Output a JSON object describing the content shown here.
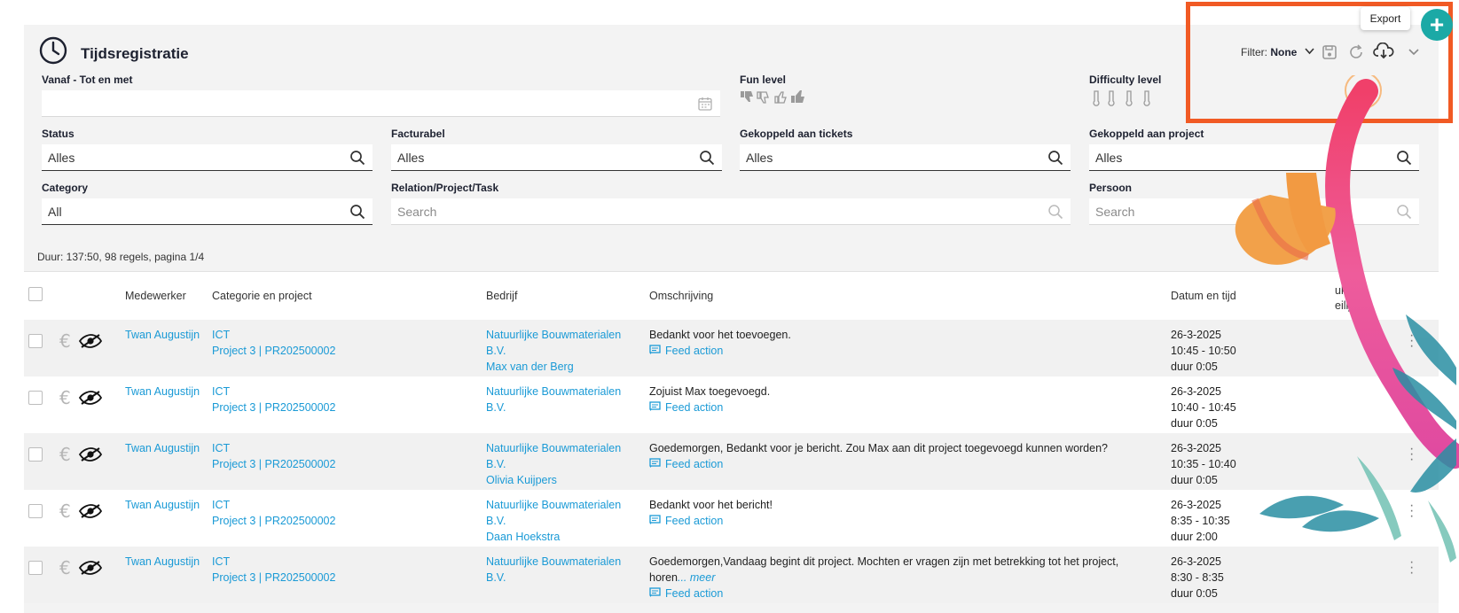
{
  "page": {
    "title": "Tijdsregistratie"
  },
  "toolbar": {
    "filter_label": "Filter:",
    "filter_value": "None",
    "export_tooltip": "Export"
  },
  "filters": {
    "date_range": {
      "label": "Vanaf - Tot en met",
      "value": ""
    },
    "fun_level": {
      "label": "Fun level"
    },
    "difficulty_level": {
      "label": "Difficulty level"
    },
    "status": {
      "label": "Status",
      "value": "Alles"
    },
    "facturabel": {
      "label": "Facturabel",
      "value": "Alles"
    },
    "gekoppeld_tickets": {
      "label": "Gekoppeld aan tickets",
      "value": "Alles"
    },
    "gekoppeld_project": {
      "label": "Gekoppeld aan project",
      "value": "Alles"
    },
    "category": {
      "label": "Category",
      "value": "All"
    },
    "relation": {
      "label": "Relation/Project/Task",
      "placeholder": "Search"
    },
    "persoon": {
      "label": "Persoon",
      "placeholder": "Search"
    }
  },
  "summary": "Duur: 137:50, 98 regels, pagina 1/4",
  "table": {
    "headers": {
      "medewerker": "Medewerker",
      "categorie": "Categorie en project",
      "bedrijf": "Bedrijf",
      "omschrijving": "Omschrijving",
      "datum": "Datum en tijd",
      "extra_1": "uk en",
      "extra_2": "eilijk"
    },
    "rows": [
      {
        "medewerker": "Twan Augustijn",
        "categorie": "ICT",
        "project": "Project 3 | PR202500002",
        "bedrijf_1": "Natuurlijke Bouwmaterialen",
        "bedrijf_2": "B.V.",
        "contact": "Max van der Berg",
        "omschrijving": "Bedankt voor het toevoegen.",
        "more": "",
        "feed": "Feed action",
        "datum": "26-3-2025",
        "tijd": "10:45 - 10:50",
        "duur": "duur 0:05"
      },
      {
        "medewerker": "Twan Augustijn",
        "categorie": "ICT",
        "project": "Project 3 | PR202500002",
        "bedrijf_1": "Natuurlijke Bouwmaterialen",
        "bedrijf_2": "B.V.",
        "contact": "",
        "omschrijving": "Zojuist Max toegevoegd.",
        "more": "",
        "feed": "Feed action",
        "datum": "26-3-2025",
        "tijd": "10:40 - 10:45",
        "duur": "duur 0:05"
      },
      {
        "medewerker": "Twan Augustijn",
        "categorie": "ICT",
        "project": "Project 3 | PR202500002",
        "bedrijf_1": "Natuurlijke Bouwmaterialen",
        "bedrijf_2": "B.V.",
        "contact": "Olivia Kuijpers",
        "omschrijving": "Goedemorgen, Bedankt voor je bericht. Zou Max aan dit project toegevoegd kunnen worden?",
        "more": "",
        "feed": "Feed action",
        "datum": "26-3-2025",
        "tijd": "10:35 - 10:40",
        "duur": "duur 0:05"
      },
      {
        "medewerker": "Twan Augustijn",
        "categorie": "ICT",
        "project": "Project 3 | PR202500002",
        "bedrijf_1": "Natuurlijke Bouwmaterialen",
        "bedrijf_2": "B.V.",
        "contact": "Daan Hoekstra",
        "omschrijving": "Bedankt voor het bericht!",
        "more": "",
        "feed": "Feed action",
        "datum": "26-3-2025",
        "tijd": "8:35 - 10:35",
        "duur": "duur 2:00"
      },
      {
        "medewerker": "Twan Augustijn",
        "categorie": "ICT",
        "project": "Project 3 | PR202500002",
        "bedrijf_1": "Natuurlijke Bouwmaterialen",
        "bedrijf_2": "B.V.",
        "contact": "",
        "omschrijving": "Goedemorgen,Vandaag begint dit project. Mochten er vragen zijn met betrekking tot het project,",
        "omschrijving_2": "horen",
        "more": "... meer",
        "feed": "Feed action",
        "datum": "26-3-2025",
        "tijd": "8:30 - 8:35",
        "duur": "duur 0:05"
      }
    ]
  },
  "colors": {
    "accent_link": "#1a9ad6",
    "highlight": "#f15a24",
    "fab": "#1ba9a6",
    "panel_bg": "#f3f3f3",
    "row_shade": "#f1f1f1"
  },
  "icons": {
    "header": "clock-icon",
    "save": "save-icon",
    "refresh": "refresh-icon",
    "export": "cloud-download-icon",
    "expand": "chevron-down-icon",
    "search": "search-icon",
    "calendar": "calendar-icon",
    "billable": "euro-icon",
    "visibility": "eye-slash-icon",
    "feed": "message-icon",
    "fab": "plus-icon"
  }
}
